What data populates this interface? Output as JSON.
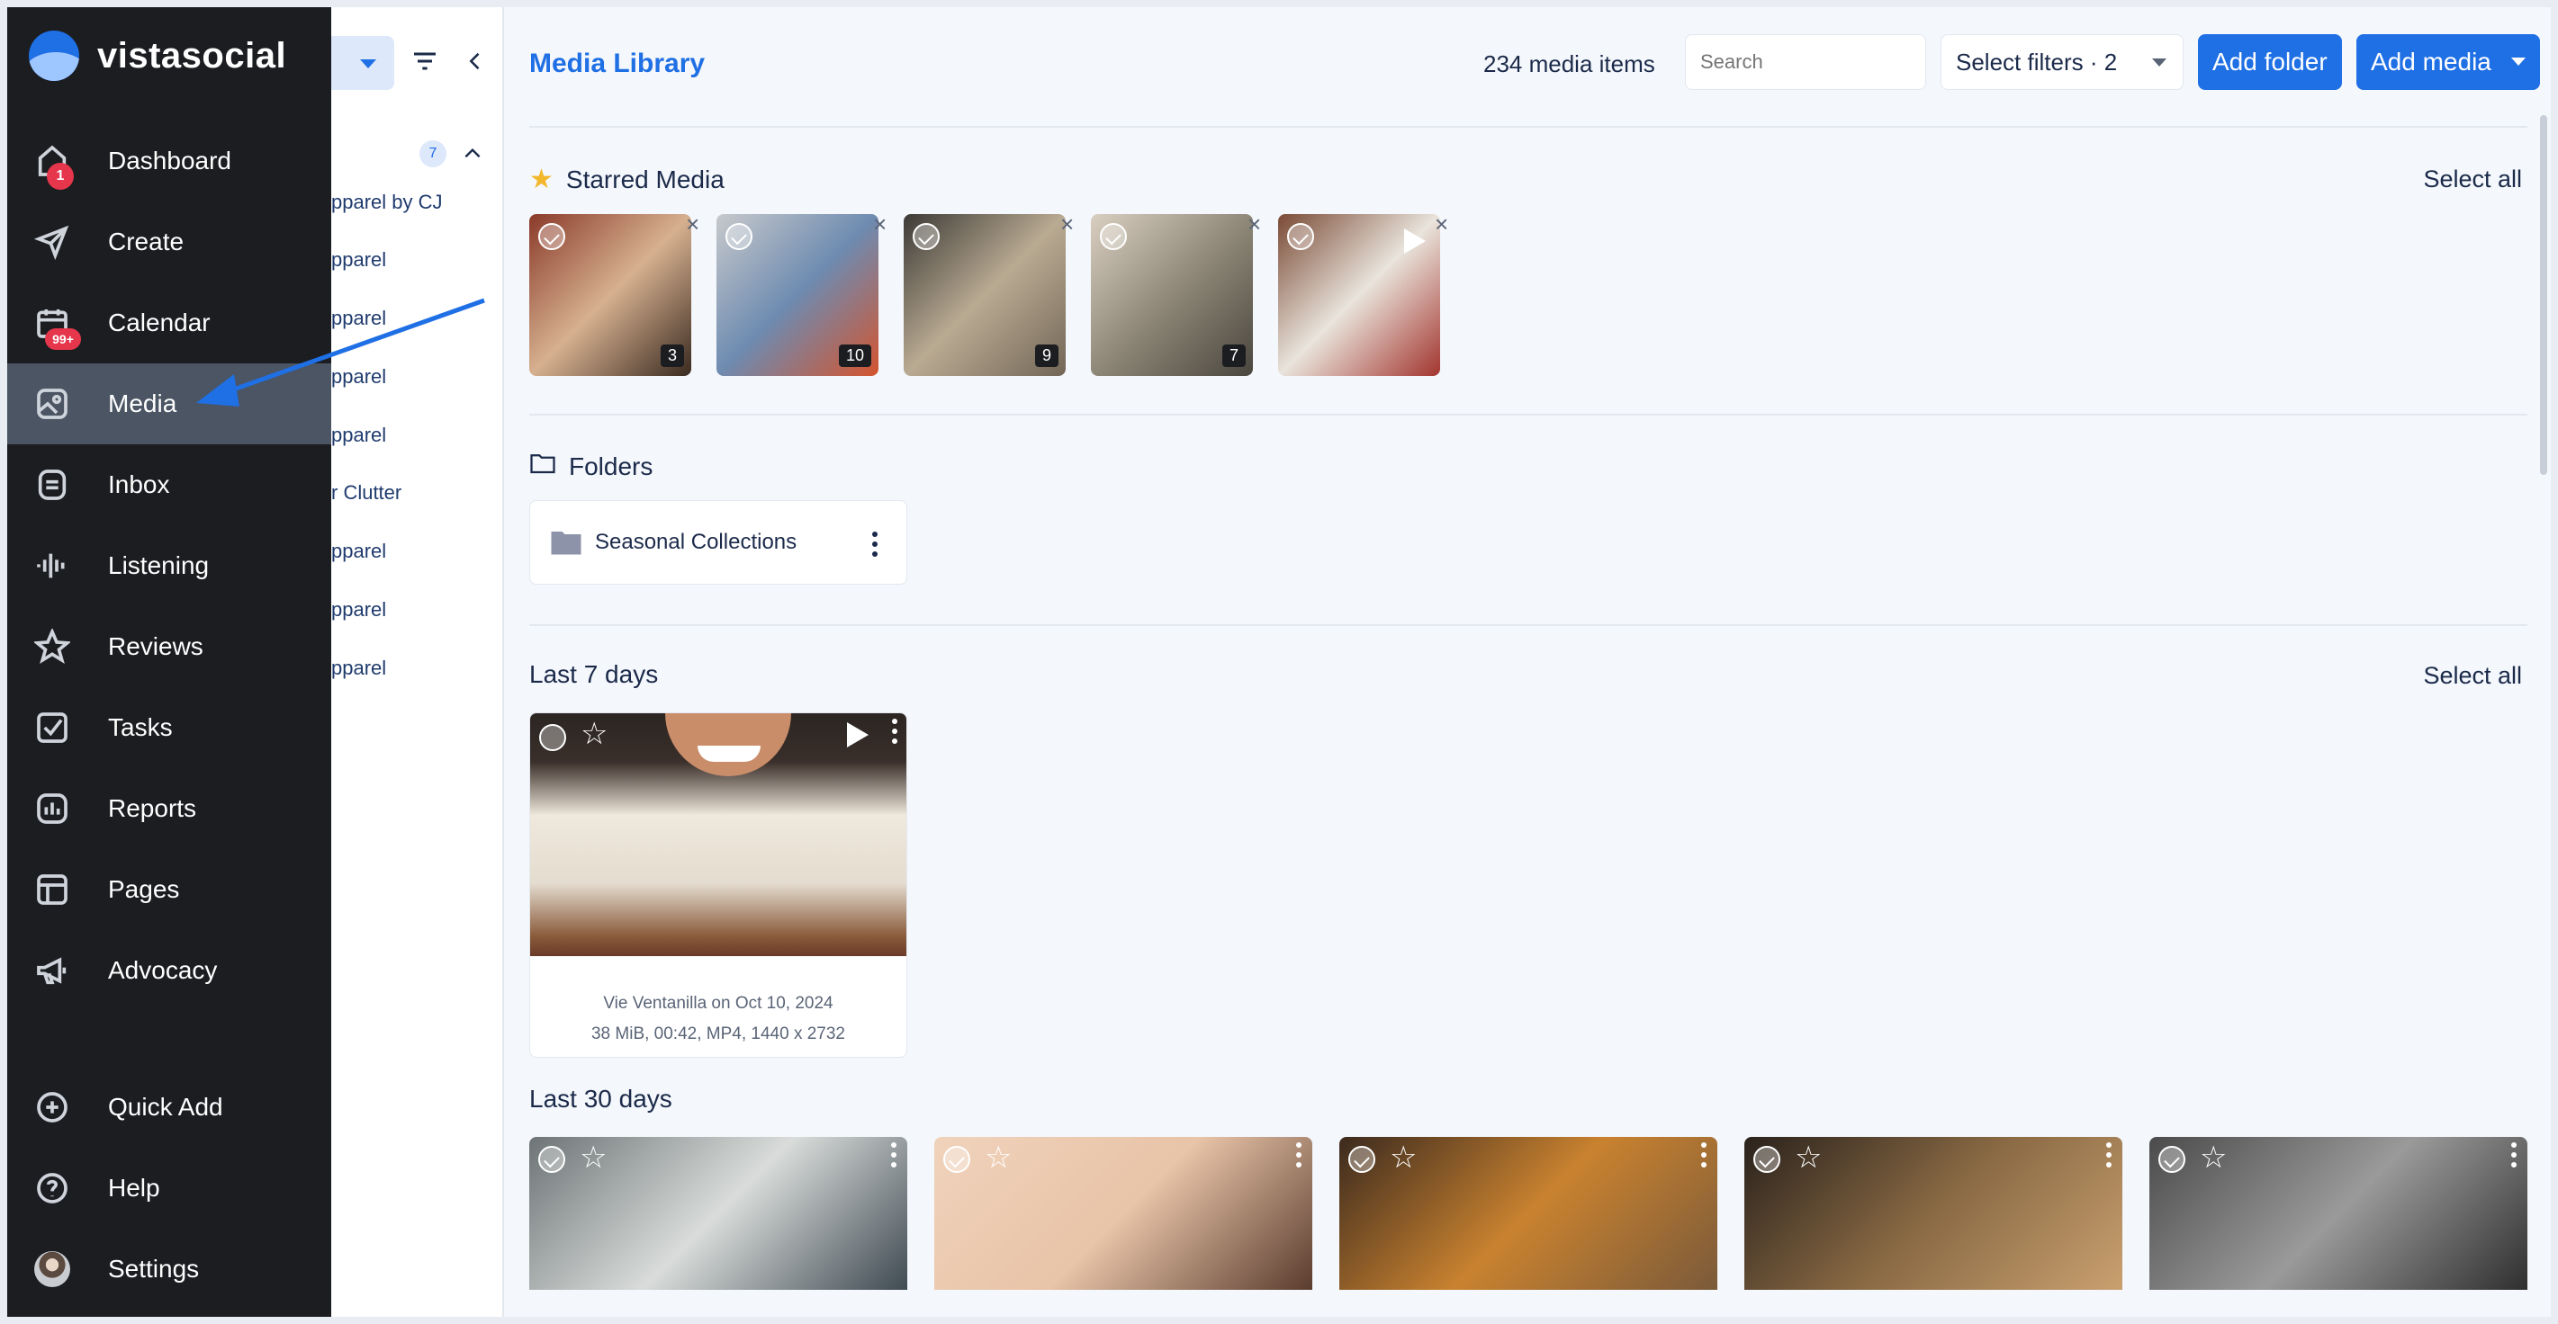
{
  "sidebar": {
    "brand": "vistasocial",
    "items": [
      {
        "label": "Dashboard",
        "icon": "home-icon",
        "badge": "1"
      },
      {
        "label": "Create",
        "icon": "send-icon"
      },
      {
        "label": "Calendar",
        "icon": "calendar-icon",
        "badge": "99+"
      },
      {
        "label": "Media",
        "icon": "media-icon",
        "active": true
      },
      {
        "label": "Inbox",
        "icon": "inbox-icon"
      },
      {
        "label": "Listening",
        "icon": "listening-icon"
      },
      {
        "label": "Reviews",
        "icon": "star-icon"
      },
      {
        "label": "Tasks",
        "icon": "checkbox-icon"
      },
      {
        "label": "Reports",
        "icon": "reports-icon"
      },
      {
        "label": "Pages",
        "icon": "pages-icon"
      },
      {
        "label": "Advocacy",
        "icon": "megaphone-icon"
      }
    ],
    "bottom": [
      {
        "label": "Quick Add",
        "icon": "plus-circle-icon"
      },
      {
        "label": "Help",
        "icon": "help-icon"
      },
      {
        "label": "Settings",
        "icon": "avatar"
      }
    ]
  },
  "profiles_panel": {
    "group_count": "7",
    "items": [
      "pparel by CJ",
      "pparel",
      "pparel",
      "pparel",
      "pparel",
      "r Clutter",
      "pparel",
      "pparel",
      "pparel"
    ]
  },
  "header": {
    "title": "Media Library",
    "media_count": "234 media items",
    "search_placeholder": "Search",
    "filters_label": "Select filters · 2",
    "add_folder": "Add folder",
    "add_media": "Add media"
  },
  "starred": {
    "title": "Starred Media",
    "select_all": "Select all",
    "items": [
      {
        "count": "3",
        "colors": [
          "#8a3a2a",
          "#d6b08f",
          "#3a2a20"
        ]
      },
      {
        "count": "10",
        "colors": [
          "#c7c9cc",
          "#6e8bb0",
          "#d4542e"
        ]
      },
      {
        "count": "9",
        "colors": [
          "#3c3a36",
          "#b9aa92",
          "#726656"
        ]
      },
      {
        "count": "7",
        "colors": [
          "#d9cfc1",
          "#8f8878",
          "#4a463e"
        ]
      },
      {
        "count": "",
        "colors": [
          "#7a4a36",
          "#e9e4dc",
          "#a2352e"
        ]
      }
    ]
  },
  "folders": {
    "title": "Folders",
    "items": [
      {
        "name": "Seasonal Collections"
      }
    ]
  },
  "last7": {
    "title": "Last 7 days",
    "select_all": "Select all",
    "card": {
      "author_line": "Vie Ventanilla on Oct 10, 2024",
      "details_line": "38 MiB, 00:42, MP4, 1440 x 2732"
    }
  },
  "last30": {
    "title": "Last 30 days",
    "items": [
      {
        "colors": [
          "#6d7476",
          "#d9dcda",
          "#3f4a52"
        ]
      },
      {
        "colors": [
          "#f0d2bb",
          "#e8c4a8",
          "#5a3c2e"
        ]
      },
      {
        "colors": [
          "#3b2a1e",
          "#c9822f",
          "#7a5a3a"
        ]
      },
      {
        "colors": [
          "#2a221c",
          "#8a6a44",
          "#c9a070"
        ]
      },
      {
        "colors": [
          "#4b4b4b",
          "#9a9a9a",
          "#2f2f2f"
        ]
      }
    ]
  }
}
